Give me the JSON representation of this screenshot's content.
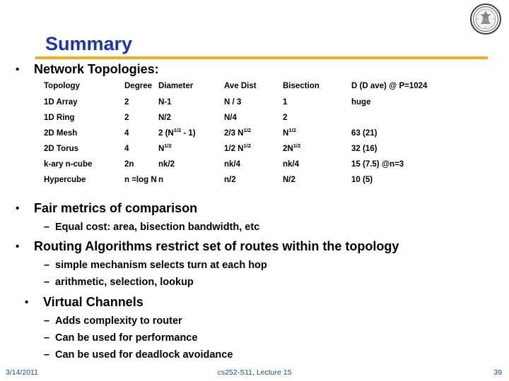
{
  "slide": {
    "title": "Summary",
    "accent_color": "#EDB01C",
    "title_color": "#1B34B5",
    "logo_name": "university-seal"
  },
  "bullets": {
    "network_topologies": "Network Topologies:",
    "fair_metrics": "Fair metrics of comparison",
    "fair_metrics_sub": [
      "Equal cost: area, bisection bandwidth, etc"
    ],
    "routing": "Routing Algorithms restrict set of routes within the topology",
    "routing_sub": [
      "simple mechanism selects turn at each hop",
      "arithmetic, selection, lookup"
    ],
    "virtual_channels": "Virtual Channels",
    "virtual_channels_sub": [
      "Adds complexity to router",
      "Can be used for performance",
      "Can be used for deadlock avoidance"
    ],
    "bullet_marker": "•",
    "dash_marker": "–"
  },
  "table": {
    "headers": [
      "Topology",
      "Degree",
      "Diameter",
      "Ave Dist",
      "Bisection",
      "D (D ave) @ P=1024"
    ],
    "rows": [
      {
        "topology": "1D Array",
        "degree": "2",
        "diameter": "N-1",
        "diameter_html": "N-1",
        "ave_dist": "N / 3",
        "ave_dist_html": "N / 3",
        "bisection": "1",
        "bisection_html": "1",
        "d_ave": "huge"
      },
      {
        "topology": "1D Ring",
        "degree": "2",
        "diameter": "N/2",
        "diameter_html": "N/2",
        "ave_dist": "N/4",
        "ave_dist_html": "N/4",
        "bisection": "2",
        "bisection_html": "2",
        "d_ave": ""
      },
      {
        "topology": "2D Mesh",
        "degree": "4",
        "diameter": "2 (N^1/2 - 1)",
        "diameter_html": "2&nbsp;(N<sup>1/2</sup> - 1)",
        "ave_dist": "2/3 N^1/2",
        "ave_dist_html": "2/3 N<sup>1/2</sup>",
        "bisection": "N^1/2",
        "bisection_html": "N<sup>1/2</sup>",
        "d_ave": "63 (21)"
      },
      {
        "topology": "2D Torus",
        "degree": "4",
        "diameter": "N^1/2",
        "diameter_html": "N<sup>1/2</sup>",
        "ave_dist": "1/2 N^1/2",
        "ave_dist_html": "1/2 N<sup>1/2</sup>",
        "bisection": "2N^1/2",
        "bisection_html": "2N<sup>1/2</sup>",
        "d_ave": "32 (16)"
      },
      {
        "topology": "k-ary n-cube",
        "degree": "2n",
        "diameter": "nk/2",
        "diameter_html": "nk/2",
        "ave_dist": "nk/4",
        "ave_dist_html": "nk/4",
        "bisection": "nk/4",
        "bisection_html": "nk/4",
        "d_ave": "15 (7.5)  @n=3"
      },
      {
        "topology": "Hypercube",
        "degree": "n =log N",
        "diameter": "n",
        "diameter_html": "n",
        "ave_dist": "n/2",
        "ave_dist_html": "n/2",
        "bisection": "N/2",
        "bisection_html": "N/2",
        "d_ave": "10 (5)"
      }
    ]
  },
  "footer": {
    "date": "3/14/2011",
    "course": "cs252-S11, Lecture 15",
    "page": "39",
    "color": "#1F4E66"
  }
}
